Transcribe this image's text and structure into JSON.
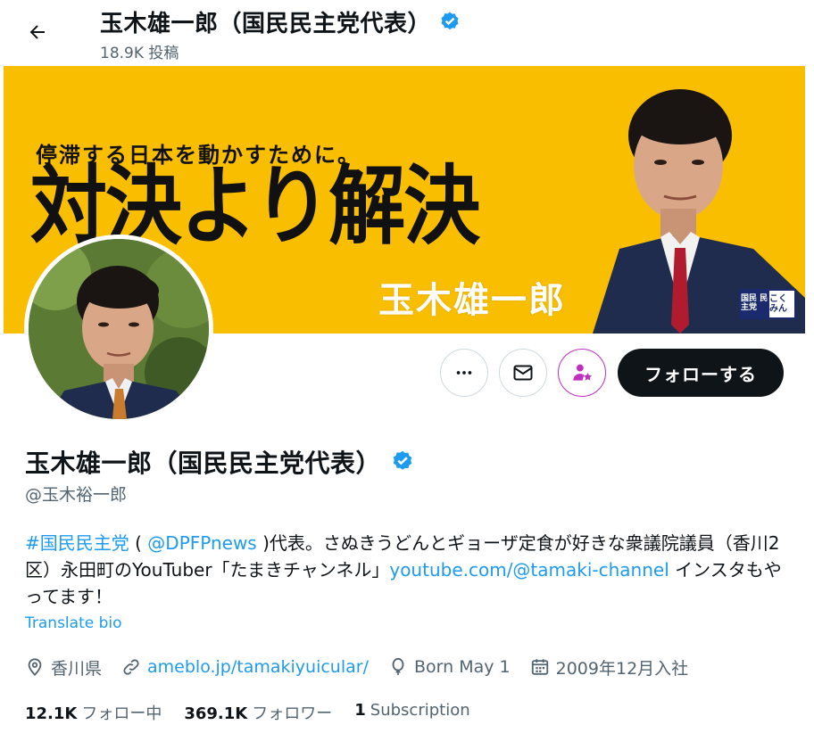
{
  "header": {
    "display_name": "玉木雄一郎（国民民主党代表）",
    "posts_count": "18.9K 投稿"
  },
  "banner": {
    "subtitle": "停滞する日本を動かすために。",
    "slogan": "対決より解決",
    "name": "玉木雄一郎",
    "logo_left": "国民 民主党",
    "logo_right": "こく みん"
  },
  "profile": {
    "display_name": "玉木雄一郎（国民民主党代表）",
    "handle": "@玉木裕一郎",
    "follow_label": "フォローする",
    "bio": {
      "hashtag": "#国民民主党",
      "paren_open": " ( ",
      "mention": "@DPFPnews",
      "text1": " )代表。さぬきうどんとギョーザ定食が好きな衆議院議員（香川2区）永田町のYouTuber「たまきチャンネル」",
      "url": "youtube.com/@tamaki-channel",
      "text2": " インスタもやってます！"
    },
    "translate_label": "Translate bio",
    "location": "香川県",
    "website": "ameblo.jp/tamakiyuicular/",
    "birthday": "Born May 1",
    "joined": "2009年12月入社"
  },
  "stats": {
    "following_count": "12.1K",
    "following_label": "フォロー中",
    "followers_count": "369.1K",
    "followers_label": "フォロワー",
    "subscriptions_count": "1",
    "subscriptions_label": "Subscription"
  },
  "colors": {
    "accent": "#1d9bf0",
    "banner_yellow": "#f9be00",
    "text_primary": "#0f1419",
    "text_secondary": "#536471",
    "subscribe_purple": "#c02fc0"
  }
}
